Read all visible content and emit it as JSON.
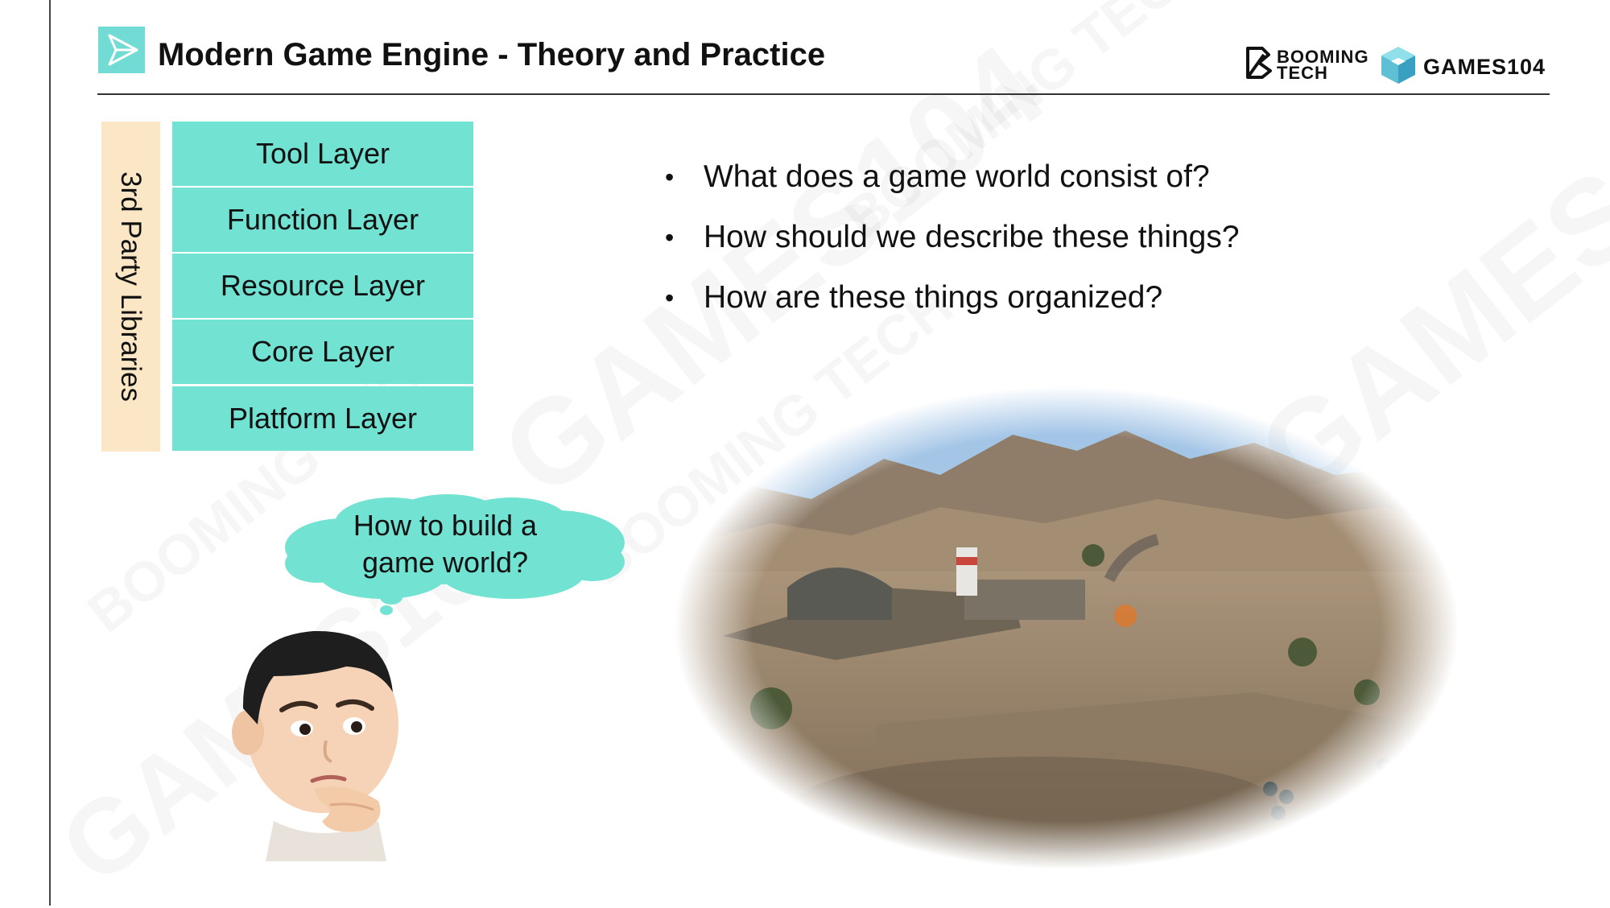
{
  "header": {
    "title": "Modern Game Engine - Theory and Practice",
    "brand_booming_line1": "BOOMING",
    "brand_booming_line2": "TECH",
    "brand_games": "GAMES104",
    "accent_color": "#72dcd4"
  },
  "sidebar": {
    "label": "3rd Party Libraries",
    "color": "#fbe6c5"
  },
  "layers": [
    {
      "label": "Tool Layer"
    },
    {
      "label": "Function Layer"
    },
    {
      "label": "Resource Layer"
    },
    {
      "label": "Core Layer"
    },
    {
      "label": "Platform Layer"
    }
  ],
  "layer_color": "#72e2d2",
  "bullets": [
    "What does a game world consist of?",
    "How should we describe these things?",
    "How are these things organized?"
  ],
  "thought_bubble": {
    "line1": "How to build a",
    "line2": "game world?"
  },
  "watermarks": [
    "GAMES104",
    "BOOMING TECH"
  ],
  "images": {
    "avatar": "thinking-boy-avatar",
    "scene": "desert-military-base-game-scene"
  }
}
